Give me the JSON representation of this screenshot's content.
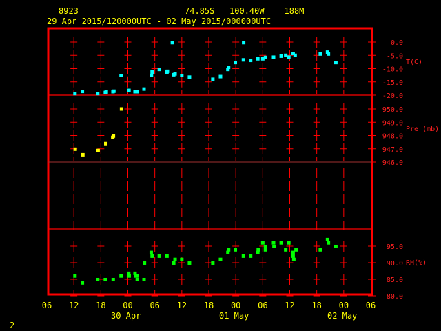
{
  "header": {
    "station": "8923",
    "location": "74.85S   100.40W    188M",
    "period": "29 Apr 2015/120000UTC - 02 May 2015/000000UTC"
  },
  "footer": {
    "page": "2"
  },
  "colors": {
    "frame": "#ff0000",
    "text": "#ffff00",
    "temp": "#00ffff",
    "pressure": "#ffff00",
    "rh": "#00ff00"
  },
  "chart_data": [
    {
      "type": "scatter",
      "title": "Temperature",
      "ylabel": "T(C)",
      "xlim": [
        0,
        72
      ],
      "x_unit": "hours from 29 Apr 06UTC",
      "ylim": [
        -20,
        5
      ],
      "yticks": [
        "0.0",
        "-5.0",
        "-10.0",
        "-15.0",
        "-20.0"
      ],
      "ytick_values": [
        0,
        -5,
        -10,
        -15,
        -20
      ],
      "points": [
        [
          6.25,
          -19.4
        ],
        [
          7.9,
          -18.6
        ],
        [
          11.3,
          -19.4
        ],
        [
          13,
          -19
        ],
        [
          13.2,
          -18.8
        ],
        [
          14.7,
          -18.7
        ],
        [
          14.9,
          -18.5
        ],
        [
          18.25,
          -18.2
        ],
        [
          19.6,
          -18.7
        ],
        [
          20,
          -18.7
        ],
        [
          21.6,
          -17.7
        ],
        [
          16.5,
          -12.6
        ],
        [
          23.25,
          -12.6
        ],
        [
          23.4,
          -11.3
        ],
        [
          25,
          -10.3
        ],
        [
          26.7,
          -11.3
        ],
        [
          26.8,
          -11
        ],
        [
          27.9,
          -0.2
        ],
        [
          28.2,
          -12.3
        ],
        [
          28.5,
          -12
        ],
        [
          30,
          -12.6
        ],
        [
          31.7,
          -13.2
        ],
        [
          36.9,
          -14
        ],
        [
          38.6,
          -13
        ],
        [
          40.25,
          -10.3
        ],
        [
          40.4,
          -9.5
        ],
        [
          41.9,
          -7.7
        ],
        [
          43.75,
          -0.2
        ],
        [
          43.7,
          -6.7
        ],
        [
          45.3,
          -6.9
        ],
        [
          46.9,
          -6.3
        ],
        [
          48,
          -6.3
        ],
        [
          48.6,
          -5.8
        ],
        [
          50.4,
          -5.7
        ],
        [
          52.1,
          -5.3
        ],
        [
          53.1,
          -5
        ],
        [
          53.8,
          -5.7
        ],
        [
          54.75,
          -4.3
        ],
        [
          55.2,
          -5
        ],
        [
          60.8,
          -4.5
        ],
        [
          62.4,
          -3.8
        ],
        [
          62.6,
          -4.5
        ],
        [
          64.25,
          -7.7
        ]
      ]
    },
    {
      "type": "scatter",
      "title": "Pressure",
      "ylabel": "Pre (mb)",
      "xlim": [
        0,
        72
      ],
      "ylim": [
        946,
        951
      ],
      "yticks": [
        "950.0",
        "949.0",
        "948.0",
        "947.0",
        "946.0"
      ],
      "ytick_values": [
        950,
        949,
        948,
        947,
        946
      ],
      "points": [
        [
          6.3,
          946.97
        ],
        [
          8,
          946.55
        ],
        [
          11.4,
          946.87
        ],
        [
          13.1,
          947.39
        ],
        [
          14.65,
          947.86
        ],
        [
          14.8,
          947.96
        ],
        [
          16.6,
          950.0
        ]
      ]
    },
    {
      "type": "scatter",
      "title": "Relative Humidity",
      "ylabel": "RH(%)",
      "xlim": [
        0,
        72
      ],
      "ylim": [
        80,
        100
      ],
      "yticks": [
        "95.0",
        "90.0",
        "85.0",
        "80.0"
      ],
      "ytick_values": [
        95,
        90,
        85,
        80
      ],
      "points": [
        [
          6.25,
          86
        ],
        [
          7.9,
          83.9
        ],
        [
          11.3,
          84.9
        ],
        [
          13,
          84.9
        ],
        [
          14.75,
          84.9
        ],
        [
          16.5,
          86
        ],
        [
          18.2,
          86.8
        ],
        [
          18.3,
          86
        ],
        [
          19.6,
          86.8
        ],
        [
          19.8,
          86
        ],
        [
          20.1,
          86
        ],
        [
          20.1,
          84.9
        ],
        [
          21.6,
          84.9
        ],
        [
          21.7,
          89.9
        ],
        [
          23.2,
          93.1
        ],
        [
          23.4,
          92
        ],
        [
          25,
          92
        ],
        [
          26.7,
          92
        ],
        [
          28.2,
          89.9
        ],
        [
          28.5,
          91
        ],
        [
          30,
          91
        ],
        [
          31.7,
          89.9
        ],
        [
          36.9,
          89.9
        ],
        [
          38.6,
          91
        ],
        [
          40.25,
          93.1
        ],
        [
          40.4,
          93.9
        ],
        [
          41.9,
          93.9
        ],
        [
          43.7,
          92
        ],
        [
          45.3,
          92
        ],
        [
          46.9,
          93.1
        ],
        [
          47,
          93.9
        ],
        [
          48,
          96
        ],
        [
          48.6,
          94.9
        ],
        [
          48.6,
          93.9
        ],
        [
          50.4,
          96
        ],
        [
          50.5,
          94.9
        ],
        [
          52.1,
          96
        ],
        [
          53.1,
          93.9
        ],
        [
          53.8,
          96
        ],
        [
          54.75,
          93.1
        ],
        [
          54.75,
          92
        ],
        [
          54.9,
          91
        ],
        [
          55.4,
          93.9
        ],
        [
          60.8,
          93.9
        ],
        [
          62.4,
          97
        ],
        [
          62.6,
          96
        ],
        [
          64.25,
          94.9
        ]
      ]
    }
  ],
  "xaxis": {
    "ticks": [
      "06",
      "12",
      "18",
      "00",
      "06",
      "12",
      "18",
      "00",
      "06",
      "12",
      "18",
      "00",
      "06"
    ],
    "dates": [
      "30 Apr",
      "01 May",
      "02 May"
    ]
  }
}
